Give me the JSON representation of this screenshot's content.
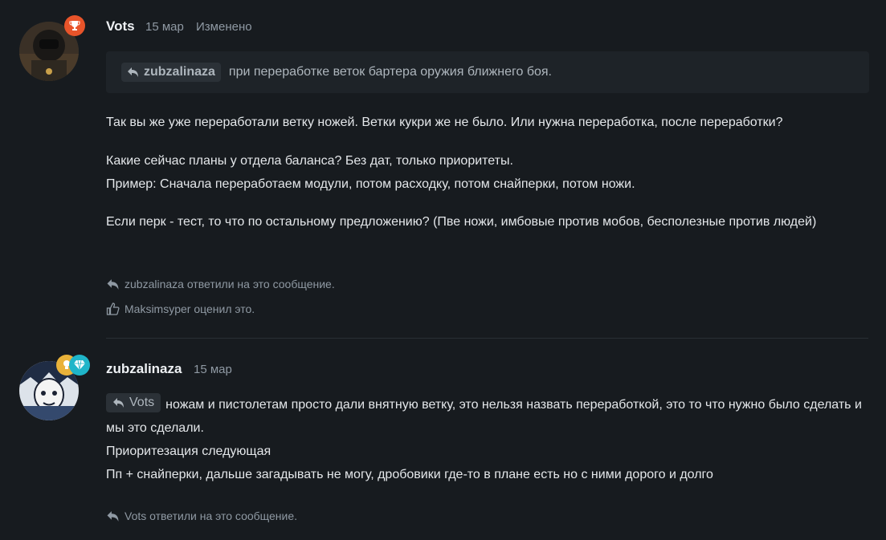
{
  "posts": [
    {
      "author": "Vots",
      "date": "15 мар",
      "edited": "Изменено",
      "quote": {
        "author": "zubzalinaza",
        "text": "при переработке веток бартера оружия ближнего боя."
      },
      "paragraphs": [
        "Так вы же уже переработали ветку ножей. Ветки кукри же не было. Или нужна переработка, после переработки?",
        "Какие сейчас планы у отдела баланса? Без дат, только приоритеты.",
        "Пример: Сначала переработаем модули, потом расходку, потом снайперки, потом ножи.",
        "Если перк - тест, то что по остальному предложению? (Пве ножи, имбовые против мобов, бесполезные против людей)"
      ],
      "replied_text": "zubzalinaza ответили на это сообщение.",
      "liked_text": "Maksimsyper оценил это.",
      "badge_icon": "trophy-icon",
      "badge_color": "#e8542a"
    },
    {
      "author": "zubzalinaza",
      "date": "15 мар",
      "quote_chip": "Vots",
      "paragraphs": [
        "ножам и пистолетам просто дали внятную ветку, это нельзя назвать переработкой, это то что нужно было сделать и мы это сделали.",
        "Приоритезация следующая",
        "Пп + снайперки, дальше загадывать не могу, дробовики где-то в плане есть но с ними дорого и долго"
      ],
      "replied_text": "Vots ответили на это сообщение.",
      "badges": [
        {
          "icon": "lightbulb-icon",
          "color": "#e9b23a"
        },
        {
          "icon": "diamond-icon",
          "color": "#1fb5c9"
        }
      ]
    }
  ]
}
